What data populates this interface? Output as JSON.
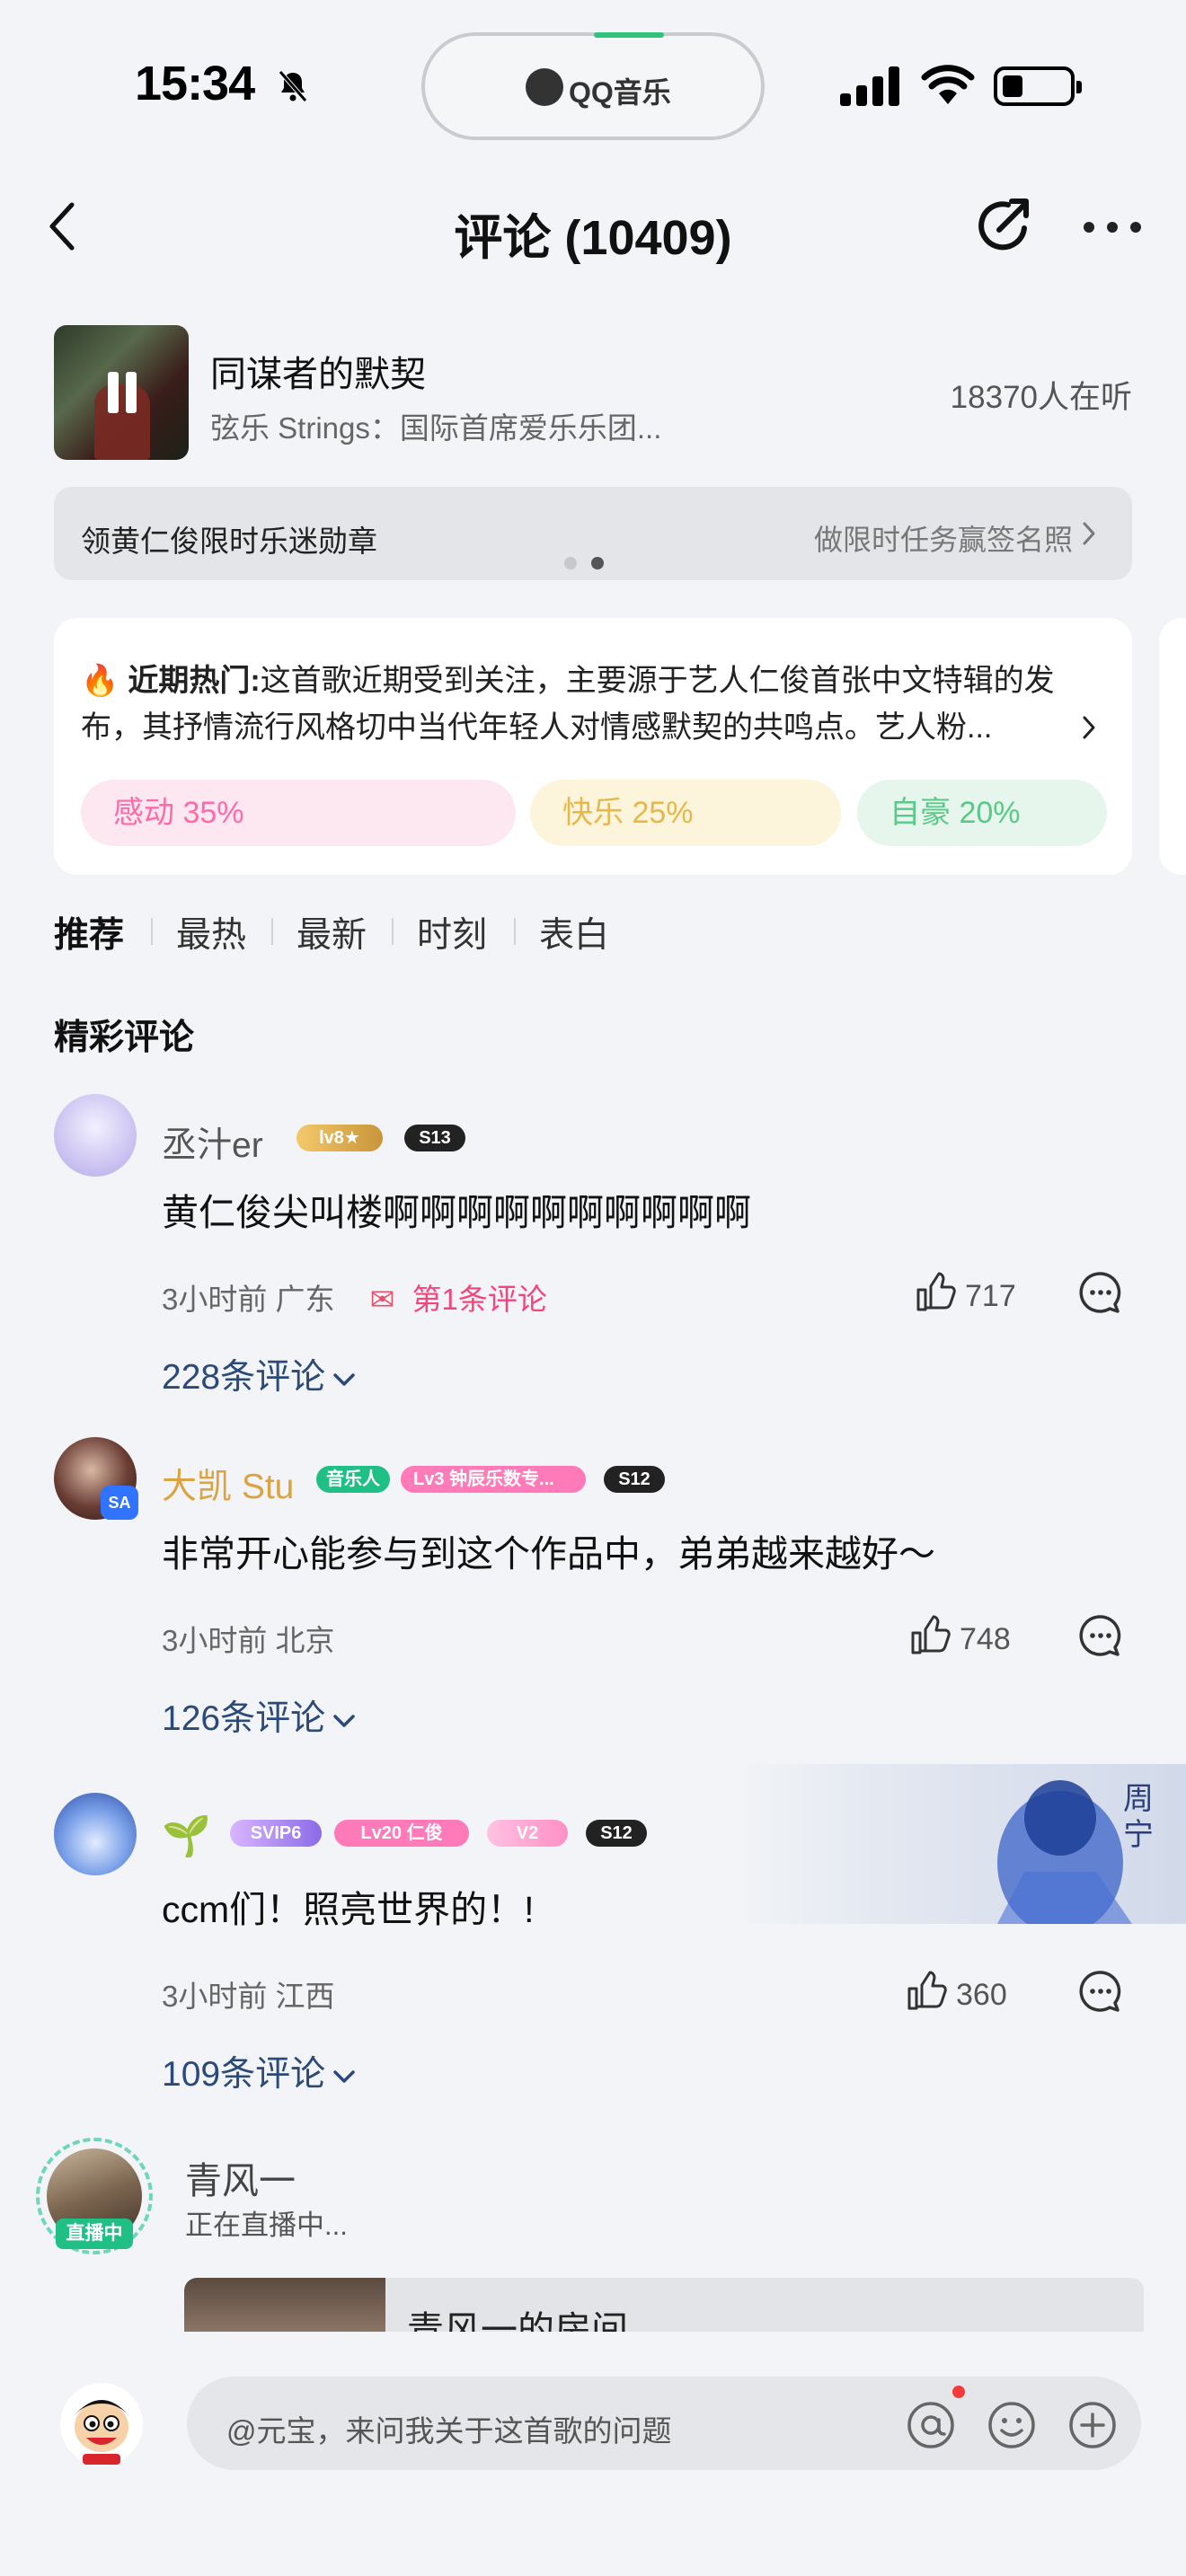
{
  "status_bar": {
    "time": "15:34",
    "island_label": "QQ音乐"
  },
  "header": {
    "title": "评论 (10409)"
  },
  "song": {
    "title": "同谋者的默契",
    "artist": "弦乐 Strings：国际首席爱乐乐团...",
    "listeners": "18370人在听"
  },
  "banner": {
    "left": "领黄仁俊限时乐迷勋章",
    "right": "做限时任务赢签名照"
  },
  "hot": {
    "label": "近期热门:",
    "text": "这首歌近期受到关注，主要源于艺人仁俊首张中文特辑的发布，其抒情流行风格切中当代年轻人对情感默契的共鸣点。艺人粉...",
    "moods": [
      {
        "label": "感动 35%"
      },
      {
        "label": "快乐 25%"
      },
      {
        "label": "自豪 20%"
      }
    ]
  },
  "tabs": [
    "推荐",
    "最热",
    "最新",
    "时刻",
    "表白"
  ],
  "section_title": "精彩评论",
  "comments": [
    {
      "user": "丞汁er",
      "badges": [
        "lv8★",
        "S13"
      ],
      "text": "黄仁俊尖叫楼啊啊啊啊啊啊啊啊啊啊",
      "meta": "3小时前 广东",
      "first_comment": "第1条评论",
      "likes": "717",
      "replies": "228条评论"
    },
    {
      "user": "大凯 Stu",
      "badges": [
        "音乐人",
        "Lv3 钟辰乐数专...",
        "S12"
      ],
      "text": "非常开心能参与到这个作品中，弟弟越来越好～",
      "meta": "3小时前 北京",
      "likes": "748",
      "replies": "126条评论"
    },
    {
      "user": "🌱",
      "badges": [
        "SVIP6",
        "Lv20 仁俊",
        "V2",
        "S12"
      ],
      "text": "ccm们！照亮世界的！!",
      "meta": "3小时前 江西",
      "likes": "360",
      "replies": "109条评论"
    }
  ],
  "live": {
    "name": "青风一",
    "status": "正在直播中...",
    "tag": "直播中",
    "room": "青风一的房间"
  },
  "input": {
    "placeholder": "@元宝，来问我关于这首歌的问题"
  },
  "colors": {
    "accent": "#31c27c",
    "reply_link": "#2b4a7a",
    "first_comment": "#f2477d",
    "user_gold": "#d9a441"
  }
}
